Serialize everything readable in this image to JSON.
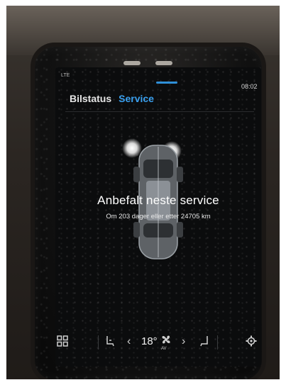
{
  "status": {
    "signal": "LTE",
    "clock": "08:02"
  },
  "tabs": [
    {
      "label": "Bilstatus"
    },
    {
      "label": "Service"
    }
  ],
  "active_tab": "Service",
  "service": {
    "title": "Anbefalt neste service",
    "subtitle": "Om 203 dager eller etter 24705 km"
  },
  "bottom_bar": {
    "apps_icon": "grid-icon",
    "seat_icon": "seat-icon",
    "temperature": "18°",
    "fan_icon": "fan-icon",
    "fan_label": "AV",
    "settings_icon": "gear-icon"
  },
  "colors": {
    "accent": "#3aa0ef",
    "screen_bg": "#0b0c0d"
  }
}
